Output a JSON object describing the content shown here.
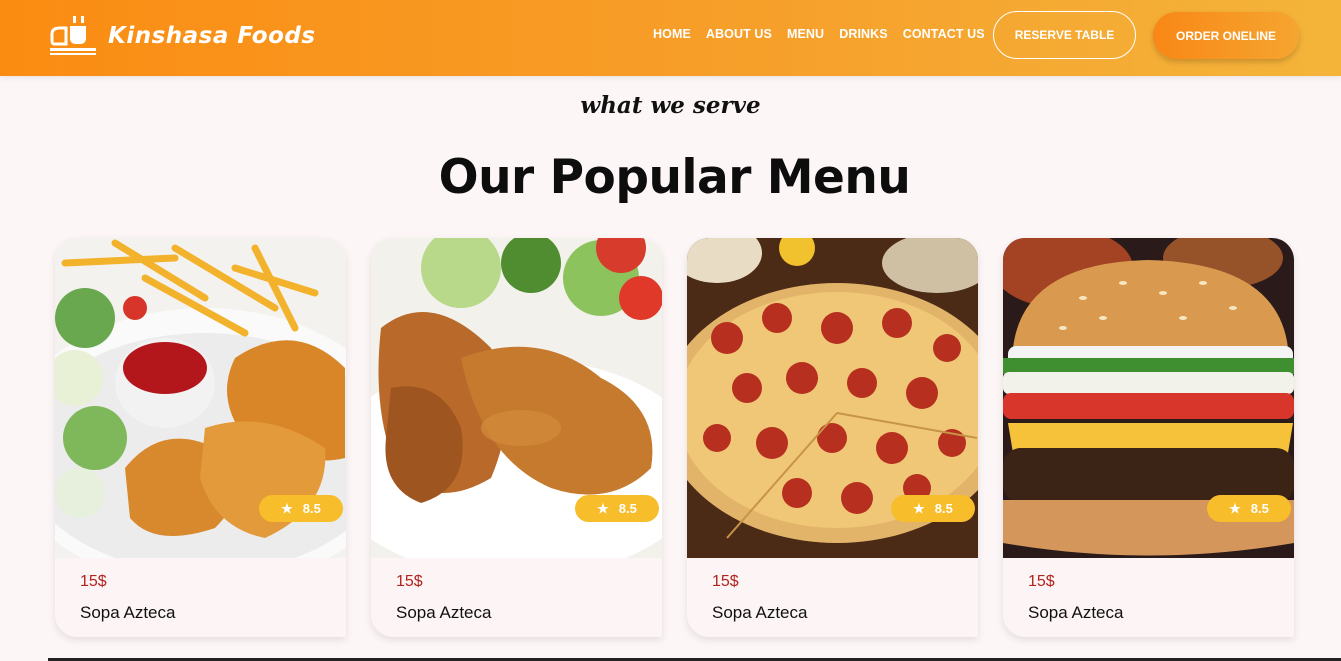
{
  "header": {
    "brand": "Kinshasa Foods",
    "nav": [
      "HOME",
      "ABOUT US",
      "MENU",
      "DRINKS",
      "CONTACT US"
    ],
    "reserve_label": "RESERVE TABLE",
    "order_label": "ORDER ONELINE"
  },
  "section": {
    "subtitle": "what we serve",
    "title": "Our Popular Menu"
  },
  "cards": [
    {
      "dish": "fried chicken with fries",
      "rating": "8.5",
      "price": "15$",
      "name": "Sopa Azteca"
    },
    {
      "dish": "roast chicken legs",
      "rating": "8.5",
      "price": "15$",
      "name": "Sopa Azteca"
    },
    {
      "dish": "pepperoni pizza",
      "rating": "8.5",
      "price": "15$",
      "name": "Sopa Azteca"
    },
    {
      "dish": "cheeseburger",
      "rating": "8.5",
      "price": "15$",
      "name": "Sopa Azteca"
    }
  ],
  "icons": {
    "logo": "food-tray-icon",
    "rating": "star-icon"
  },
  "colors": {
    "accent": "#fb8c12",
    "rating_badge": "#f7bd2a",
    "price": "#b3231e"
  }
}
